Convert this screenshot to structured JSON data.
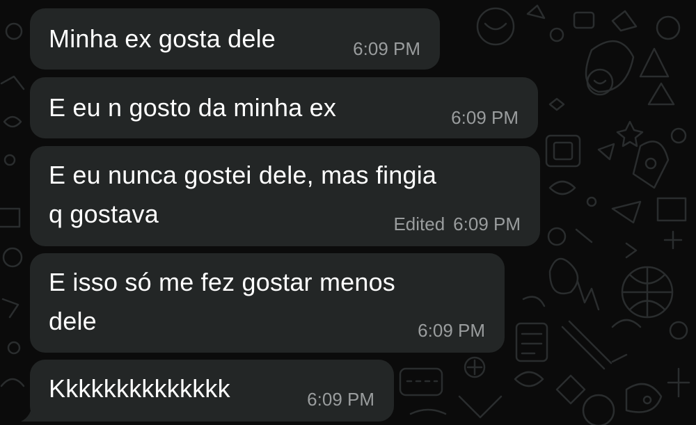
{
  "chat": {
    "messages": [
      {
        "text_lines": [
          "Minha ex gosta dele"
        ],
        "time": "6:09 PM",
        "edited": ""
      },
      {
        "text_lines": [
          "E eu n gosto da minha ex"
        ],
        "time": "6:09 PM",
        "edited": ""
      },
      {
        "text_lines": [
          "E eu nunca gostei dele, mas fingia",
          "q gostava"
        ],
        "time": "6:09 PM",
        "edited": "Edited"
      },
      {
        "text_lines": [
          "E isso só me fez gostar menos",
          "dele"
        ],
        "time": "6:09 PM",
        "edited": ""
      },
      {
        "text_lines": [
          "Kkkkkkkkkkkkkk"
        ],
        "time": "6:09 PM",
        "edited": ""
      }
    ]
  },
  "colors": {
    "background": "#0b0b0b",
    "bubble": "#232626",
    "message_text": "#ffffff",
    "meta_text": "#9a9d9e",
    "wallpaper_doodle": "#2a2d2e"
  }
}
